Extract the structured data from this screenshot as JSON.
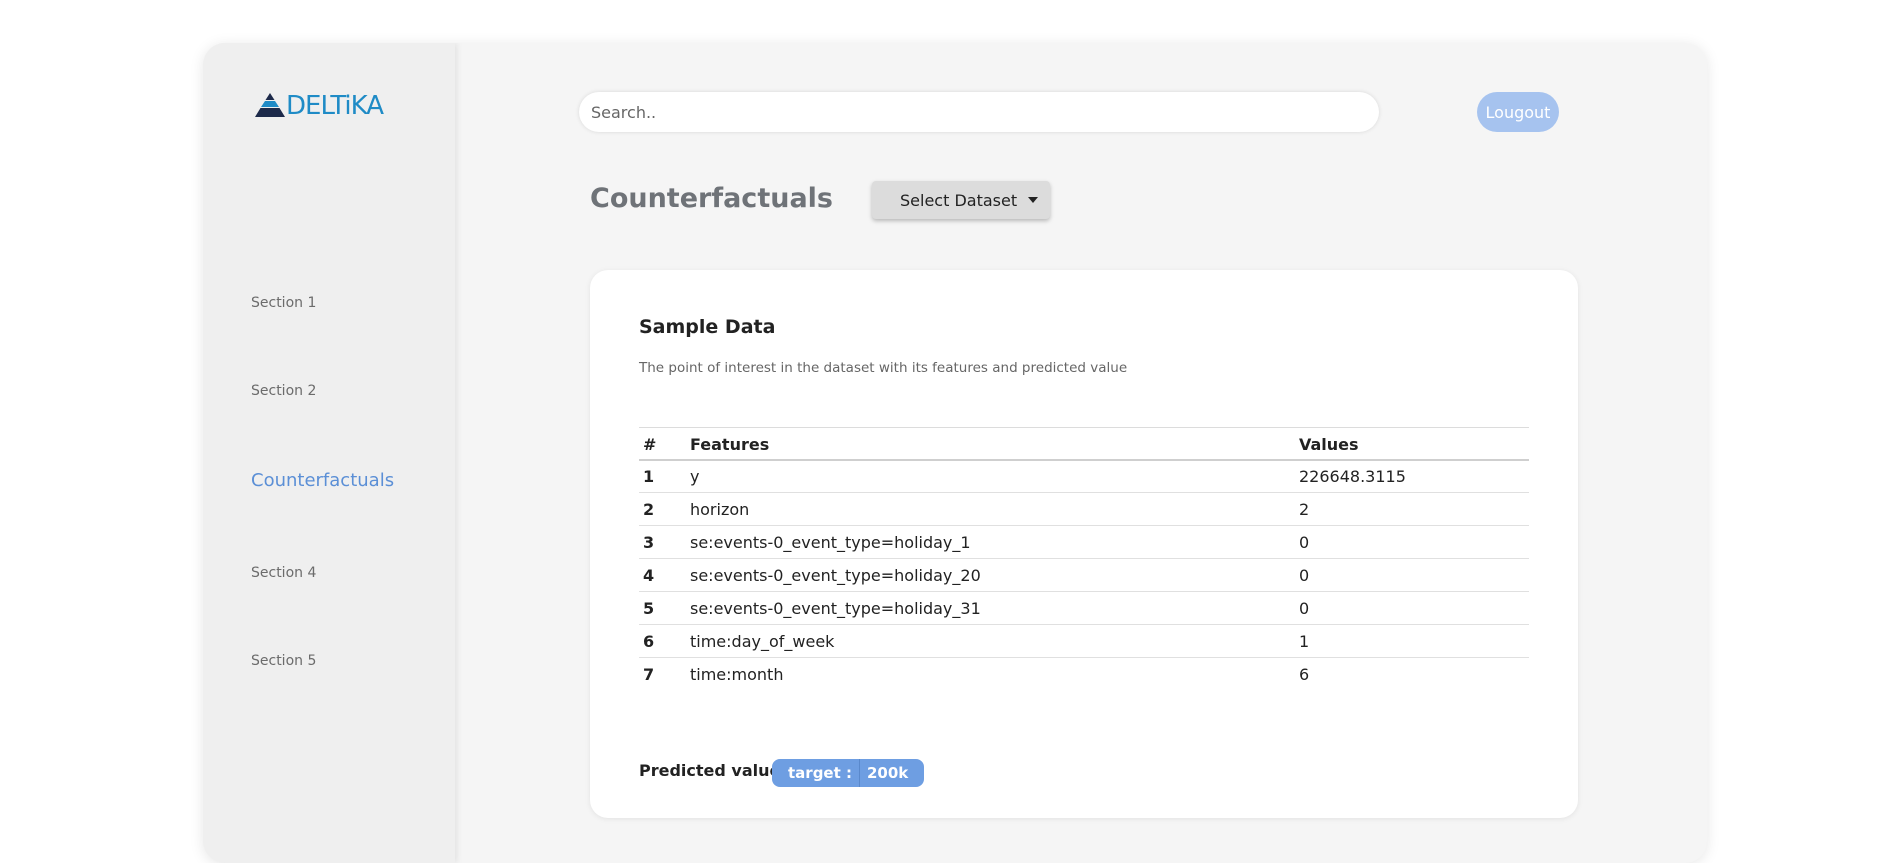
{
  "brand": {
    "logo_text": "DELTiKA"
  },
  "sidebar": {
    "items": [
      {
        "label": "Section 1",
        "active": false
      },
      {
        "label": "Section 2",
        "active": false
      },
      {
        "label": "Counterfactuals",
        "active": true
      },
      {
        "label": "Section 4",
        "active": false
      },
      {
        "label": "Section 5",
        "active": false
      }
    ]
  },
  "header": {
    "search_placeholder": "Search..",
    "logout_label": "Lougout"
  },
  "page": {
    "title": "Counterfactuals",
    "dataset_button_label": "Select Dataset"
  },
  "card": {
    "title": "Sample Data",
    "subtitle": "The point of interest in the dataset with its features and predicted value",
    "table": {
      "headers": [
        "#",
        "Features",
        "Values"
      ],
      "rows": [
        [
          "1",
          "y",
          "226648.3115"
        ],
        [
          "2",
          "horizon",
          "2"
        ],
        [
          "3",
          "se:events-0_event_type=holiday_1",
          "0"
        ],
        [
          "4",
          "se:events-0_event_type=holiday_20",
          "0"
        ],
        [
          "5",
          "se:events-0_event_type=holiday_31",
          "0"
        ],
        [
          "6",
          "time:day_of_week",
          "1"
        ],
        [
          "7",
          "time:month",
          "6"
        ]
      ]
    },
    "predicted_label": "Predicted value",
    "badge_key": "target :",
    "badge_value": "200k"
  },
  "colors": {
    "accent": "#5b8fd6",
    "badge": "#6e9ee2",
    "logout": "#a6c3ef",
    "logo_blue": "#1f8bc6",
    "logo_dark": "#1d2a4a"
  }
}
